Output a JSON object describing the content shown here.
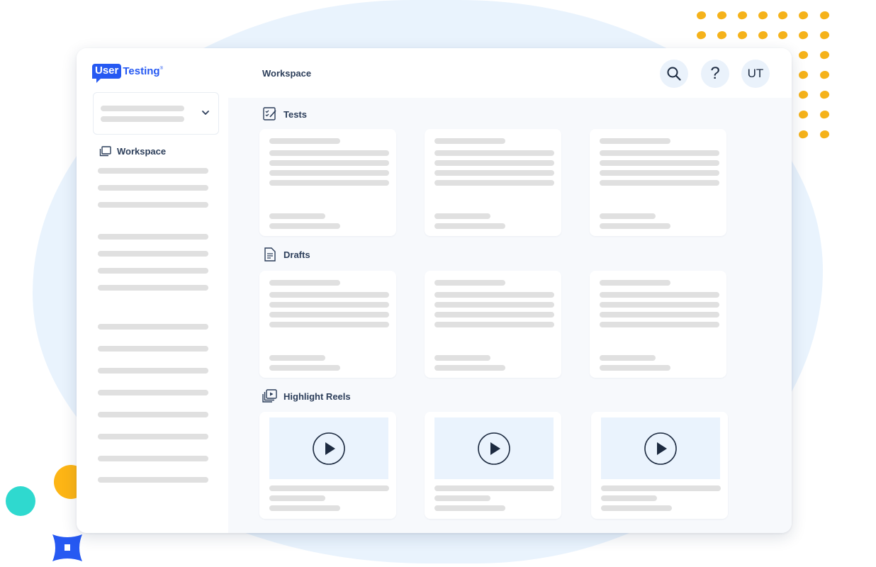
{
  "app": {
    "logo_user": "User",
    "logo_testing": "Testing",
    "logo_tm": "®"
  },
  "header": {
    "title": "Workspace",
    "avatar_initials": "UT",
    "help_symbol": "?"
  },
  "sidebar": {
    "workspace_label": "Workspace"
  },
  "sections": {
    "tests": "Tests",
    "drafts": "Drafts",
    "highlight_reels": "Highlight Reels"
  },
  "colors": {
    "brand": "#2659f2",
    "accent_yellow": "#f5b21a",
    "accent_teal": "#2fd9cf",
    "backdrop": "#e9f3fd"
  },
  "icons": {
    "search": "search-icon",
    "help": "help-icon",
    "workspace": "workspace-icon",
    "tests": "checklist-icon",
    "drafts": "document-icon",
    "highlight_reels": "video-stack-icon",
    "play": "play-icon",
    "selector": "chevron-down-icon"
  }
}
